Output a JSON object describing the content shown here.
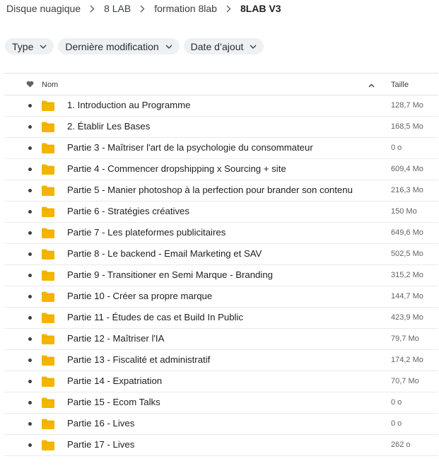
{
  "breadcrumb": [
    "Disque nuagique",
    "8 LAB",
    "formation 8lab",
    "8LAB V3"
  ],
  "filters": [
    "Type",
    "Dernière modification",
    "Date d’ajout"
  ],
  "table": {
    "col_name": "Nom",
    "col_size": "Taille",
    "rows": [
      {
        "name": "1. Introduction au Programme",
        "size": "128,7 Mo"
      },
      {
        "name": "2. Établir Les Bases",
        "size": "168,5 Mo"
      },
      {
        "name": "Partie 3 - Maîtriser l'art de la psychologie du consommateur",
        "size": "0 o"
      },
      {
        "name": "Partie 4 - Commencer dropshipping x Sourcing + site",
        "size": "609,4 Mo"
      },
      {
        "name": "Partie 5 - Manier photoshop à la perfection pour brander son contenu",
        "size": "216,3 Mo"
      },
      {
        "name": "Partie 6 - Stratégies créatives",
        "size": "150 Mo"
      },
      {
        "name": "Partie 7 - Les plateformes publicitaires",
        "size": "649,6 Mo"
      },
      {
        "name": "Partie 8 - Le backend - Email Marketing et SAV",
        "size": "502,5 Mo"
      },
      {
        "name": "Partie 9 - Transitioner en Semi Marque - Branding",
        "size": "315,2 Mo"
      },
      {
        "name": "Partie 10 - Créer sa propre marque",
        "size": "144,7 Mo"
      },
      {
        "name": "Partie 11 - Études de cas et Build In Public",
        "size": "423,9 Mo"
      },
      {
        "name": "Partie 12 - Maîtriser l'IA",
        "size": "79,7 Mo"
      },
      {
        "name": "Partie 13 - Fiscalité et administratif",
        "size": "174,2 Mo"
      },
      {
        "name": "Partie 14 - Expatriation",
        "size": "70,7 Mo"
      },
      {
        "name": "Partie 15 - Ecom Talks",
        "size": "0 o"
      },
      {
        "name": "Partie 16 - Lives",
        "size": "0 o"
      },
      {
        "name": "Partie 17 - Lives",
        "size": "262 o"
      }
    ]
  },
  "icons": {
    "folder": "folder-icon",
    "heart": "heart-icon",
    "sort": "sort-ascending-icon",
    "chevron": "chevron-down-icon",
    "separator": "chevron-right-icon"
  },
  "colors": {
    "folder": "#F5B400",
    "chip_bg": "#EEF1F4"
  }
}
